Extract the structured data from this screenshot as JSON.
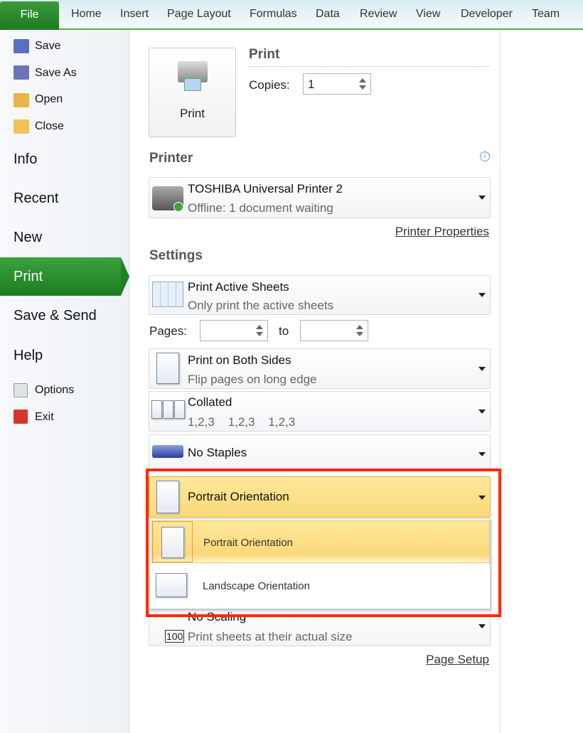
{
  "ribbon": {
    "tabs": [
      "File",
      "Home",
      "Insert",
      "Page Layout",
      "Formulas",
      "Data",
      "Review",
      "View",
      "Developer",
      "Team"
    ]
  },
  "sidebar": {
    "small_top": [
      "Save",
      "Save As",
      "Open",
      "Close"
    ],
    "big": [
      "Info",
      "Recent",
      "New",
      "Print",
      "Save & Send",
      "Help"
    ],
    "small_bottom": [
      "Options",
      "Exit"
    ],
    "selected": "Print"
  },
  "print": {
    "button_label": "Print",
    "heading": "Print",
    "copies_label": "Copies:",
    "copies_value": "1"
  },
  "printer": {
    "heading": "Printer",
    "name": "TOSHIBA Universal Printer 2",
    "status": "Offline: 1 document waiting",
    "properties_link": "Printer Properties"
  },
  "settings": {
    "heading": "Settings",
    "sheets": {
      "title": "Print Active Sheets",
      "subtitle": "Only print the active sheets"
    },
    "pages_label": "Pages:",
    "to_label": "to",
    "pages_from": "",
    "pages_to": "",
    "sides": {
      "title": "Print on Both Sides",
      "subtitle": "Flip pages on long edge"
    },
    "collate": {
      "title": "Collated",
      "subtitle": "1,2,3    1,2,3    1,2,3"
    },
    "staples": {
      "title": "No Staples"
    },
    "orientation": {
      "title": "Portrait Orientation",
      "options": [
        "Portrait Orientation",
        "Landscape Orientation"
      ]
    },
    "scaling": {
      "title": "No Scaling",
      "subtitle": "Print sheets at their actual size",
      "icon_text": "100"
    },
    "page_setup_link": "Page Setup"
  },
  "colors": {
    "accent_green": "#2a8c2c",
    "highlight": "#fde28a",
    "callout": "#ff2a00"
  }
}
